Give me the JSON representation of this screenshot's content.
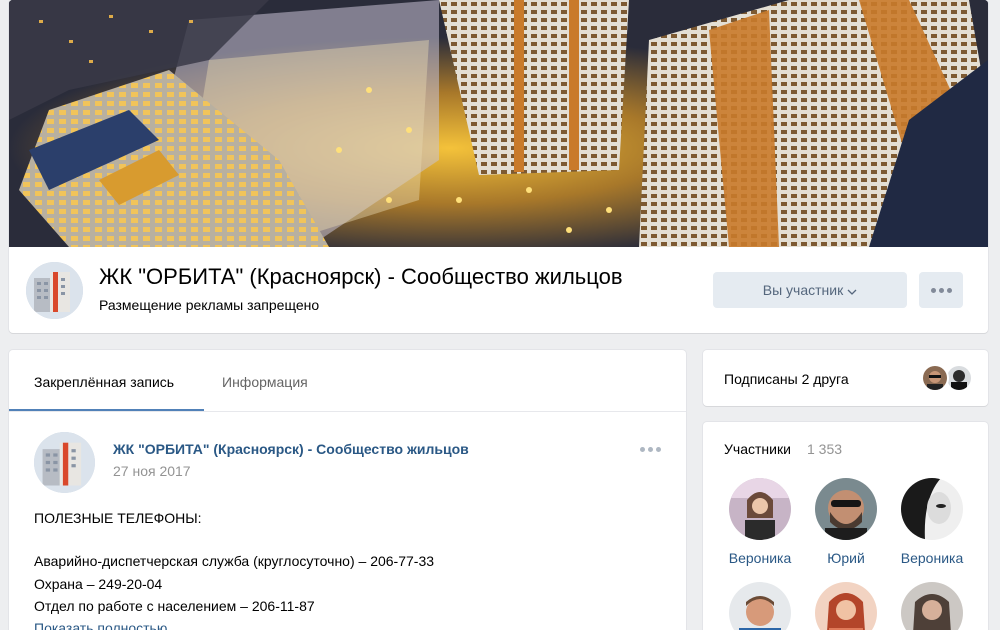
{
  "header": {
    "title": "ЖК \"ОРБИТА\" (Красноярск) - Сообщество жильцов",
    "status": "Размещение рекламы запрещено",
    "member_button": "Вы участник",
    "member_button_icon": "chevron-down-icon",
    "more_icon": "more-horizontal-icon"
  },
  "tabs": [
    {
      "label": "Закреплённая запись",
      "active": true
    },
    {
      "label": "Информация",
      "active": false
    }
  ],
  "post": {
    "author": "ЖК \"ОРБИТА\" (Красноярск) - Сообщество жильцов",
    "date": "27 ноя 2017",
    "lines": [
      "ПОЛЕЗНЫЕ ТЕЛЕФОНЫ:",
      "Аварийно-диспетчерская служба (круглосуточно) – 206-77-33",
      "Охрана – 249-20-04",
      "Отдел по работе с населением – 206-11-87"
    ],
    "show_more": "Показать полностью..."
  },
  "friends": {
    "label": "Подписаны 2 друга"
  },
  "members": {
    "title": "Участники",
    "count": "1 353",
    "items": [
      {
        "name": "Вероника"
      },
      {
        "name": "Юрий"
      },
      {
        "name": "Вероника"
      },
      {
        "name": ""
      },
      {
        "name": ""
      },
      {
        "name": ""
      }
    ]
  },
  "colors": {
    "background": "#edeef0",
    "link": "#2a5885",
    "accent": "#5181b8",
    "button_bg": "#e5ebf1",
    "button_text": "#55677d"
  }
}
